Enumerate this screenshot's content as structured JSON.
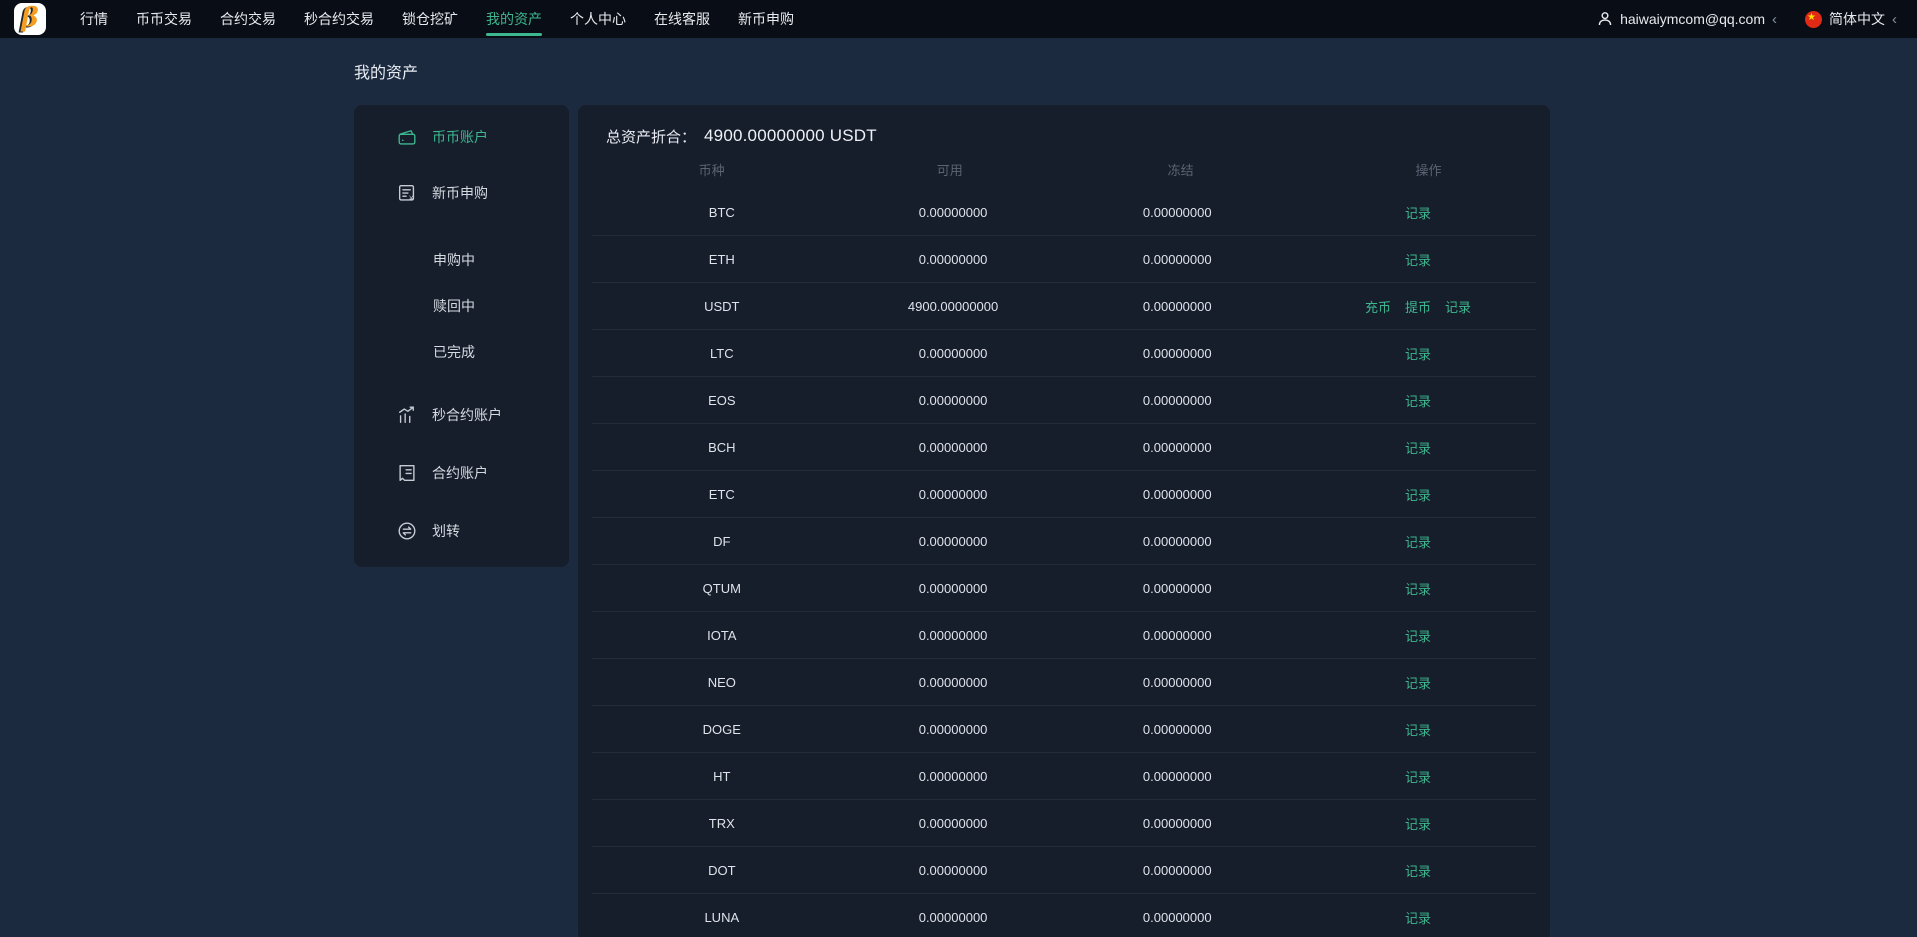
{
  "topnav": {
    "nav_items": [
      {
        "label": "行情",
        "active": false
      },
      {
        "label": "币币交易",
        "active": false
      },
      {
        "label": "合约交易",
        "active": false
      },
      {
        "label": "秒合约交易",
        "active": false
      },
      {
        "label": "锁仓挖矿",
        "active": false
      },
      {
        "label": "我的资产",
        "active": true
      },
      {
        "label": "个人中心",
        "active": false
      },
      {
        "label": "在线客服",
        "active": false
      },
      {
        "label": "新币申购",
        "active": false
      }
    ],
    "user_email": "haiwaiymcom@qq.com",
    "user_chevron": "‹",
    "language": "简体中文",
    "language_chevron": "‹"
  },
  "page_title": "我的资产",
  "sidebar": {
    "items": [
      {
        "label": "币币账户",
        "active": true
      },
      {
        "label": "新币申购",
        "active": false
      },
      {
        "label": "申购中",
        "active": false
      },
      {
        "label": "赎回中",
        "active": false
      },
      {
        "label": "已完成",
        "active": false
      },
      {
        "label": "秒合约账户",
        "active": false
      },
      {
        "label": "合约账户",
        "active": false
      },
      {
        "label": "划转",
        "active": false
      }
    ]
  },
  "assets": {
    "total_label": "总资产折合：",
    "total_value": "4900.00000000 USDT",
    "columns": [
      "币种",
      "可用",
      "冻结",
      "操作"
    ],
    "rows": [
      {
        "coin": "BTC",
        "available": "0.00000000",
        "frozen": "0.00000000",
        "actions": [
          {
            "label": "记录",
            "name": "record"
          }
        ]
      },
      {
        "coin": "ETH",
        "available": "0.00000000",
        "frozen": "0.00000000",
        "actions": [
          {
            "label": "记录",
            "name": "record"
          }
        ]
      },
      {
        "coin": "USDT",
        "available": "4900.00000000",
        "frozen": "0.00000000",
        "actions": [
          {
            "label": "充币",
            "name": "deposit"
          },
          {
            "label": "提币",
            "name": "withdraw"
          },
          {
            "label": "记录",
            "name": "record"
          }
        ]
      },
      {
        "coin": "LTC",
        "available": "0.00000000",
        "frozen": "0.00000000",
        "actions": [
          {
            "label": "记录",
            "name": "record"
          }
        ]
      },
      {
        "coin": "EOS",
        "available": "0.00000000",
        "frozen": "0.00000000",
        "actions": [
          {
            "label": "记录",
            "name": "record"
          }
        ]
      },
      {
        "coin": "BCH",
        "available": "0.00000000",
        "frozen": "0.00000000",
        "actions": [
          {
            "label": "记录",
            "name": "record"
          }
        ]
      },
      {
        "coin": "ETC",
        "available": "0.00000000",
        "frozen": "0.00000000",
        "actions": [
          {
            "label": "记录",
            "name": "record"
          }
        ]
      },
      {
        "coin": "DF",
        "available": "0.00000000",
        "frozen": "0.00000000",
        "actions": [
          {
            "label": "记录",
            "name": "record"
          }
        ]
      },
      {
        "coin": "QTUM",
        "available": "0.00000000",
        "frozen": "0.00000000",
        "actions": [
          {
            "label": "记录",
            "name": "record"
          }
        ]
      },
      {
        "coin": "IOTA",
        "available": "0.00000000",
        "frozen": "0.00000000",
        "actions": [
          {
            "label": "记录",
            "name": "record"
          }
        ]
      },
      {
        "coin": "NEO",
        "available": "0.00000000",
        "frozen": "0.00000000",
        "actions": [
          {
            "label": "记录",
            "name": "record"
          }
        ]
      },
      {
        "coin": "DOGE",
        "available": "0.00000000",
        "frozen": "0.00000000",
        "actions": [
          {
            "label": "记录",
            "name": "record"
          }
        ]
      },
      {
        "coin": "HT",
        "available": "0.00000000",
        "frozen": "0.00000000",
        "actions": [
          {
            "label": "记录",
            "name": "record"
          }
        ]
      },
      {
        "coin": "TRX",
        "available": "0.00000000",
        "frozen": "0.00000000",
        "actions": [
          {
            "label": "记录",
            "name": "record"
          }
        ]
      },
      {
        "coin": "DOT",
        "available": "0.00000000",
        "frozen": "0.00000000",
        "actions": [
          {
            "label": "记录",
            "name": "record"
          }
        ]
      },
      {
        "coin": "LUNA",
        "available": "0.00000000",
        "frozen": "0.00000000",
        "actions": [
          {
            "label": "记录",
            "name": "record"
          }
        ]
      }
    ]
  },
  "colors": {
    "accent_green": "#3eb78f",
    "navbar_bg": "#090d15",
    "page_bg": "#1c2a40",
    "card_bg": "#161d2b",
    "flag_red": "#df2a16",
    "logo_orange": "#f59d1e"
  }
}
